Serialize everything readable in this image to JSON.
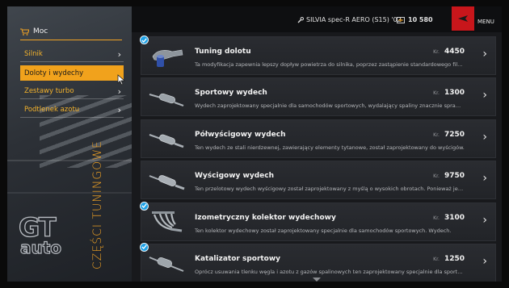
{
  "sidebar": {
    "category_title": "Moc",
    "vertical_title": "CZĘŚCI TUNINGOWE",
    "items": [
      {
        "label": "Silnik",
        "active": false
      },
      {
        "label": "Doloty i wydechy",
        "active": true
      },
      {
        "label": "Zestawy turbo",
        "active": false
      },
      {
        "label": "Podtlenek azotu",
        "active": false
      }
    ],
    "logo_text": "GT auto"
  },
  "topbar": {
    "car_name": "SILVIA spec-R AERO (S15) '02",
    "credits": "10 580",
    "menu_label": "MENU"
  },
  "parts": [
    {
      "name": "Tuning dolotu",
      "price": "4450",
      "currency": "Kr.",
      "owned": true,
      "thumb": "intake-part-icon",
      "description": "Ta modyfikacja zapewnia lepszy dopływ powietrza do silnika, poprzez zastąpienie standardowego filtra powietrza."
    },
    {
      "name": "Sportowy wydech",
      "price": "1300",
      "currency": "Kr.",
      "owned": false,
      "thumb": "exhaust-part-icon",
      "description": "Wydech zaprojektowany specjalnie dla samochodów sportowych, wydalający spaliny znacznie sprawniej."
    },
    {
      "name": "Półwyścigowy wydech",
      "price": "7250",
      "currency": "Kr.",
      "owned": false,
      "thumb": "exhaust-part-icon",
      "description": "Ten wydech ze stali nierdzewnej, zawierający elementy tytanowe, został zaprojektowany do wyścigów."
    },
    {
      "name": "Wyścigowy wydech",
      "price": "9750",
      "currency": "Kr.",
      "owned": false,
      "thumb": "exhaust-part-icon",
      "description": "Ten przelotowy wydech wyścigowy został zaprojektowany z myślą o wysokich obrotach. Ponieważ jest głośny."
    },
    {
      "name": "Izometryczny kolektor wydechowy",
      "price": "3100",
      "currency": "Kr.",
      "owned": true,
      "thumb": "manifold-part-icon",
      "description": "Ten kolektor wydechowy został zaprojektowany specjalnie dla samochodów sportowych. Wydech."
    },
    {
      "name": "Katalizator sportowy",
      "price": "1250",
      "currency": "Kr.",
      "owned": true,
      "thumb": "catalyst-part-icon",
      "description": "Oprócz usuwania tlenku węgla i azotu z gazów spalinowych ten zaprojektowany specjalnie dla sportowych."
    }
  ],
  "colors": {
    "accent": "#f1a21c",
    "owned_badge": "#1da1e6",
    "menu_button": "#c8161b"
  }
}
